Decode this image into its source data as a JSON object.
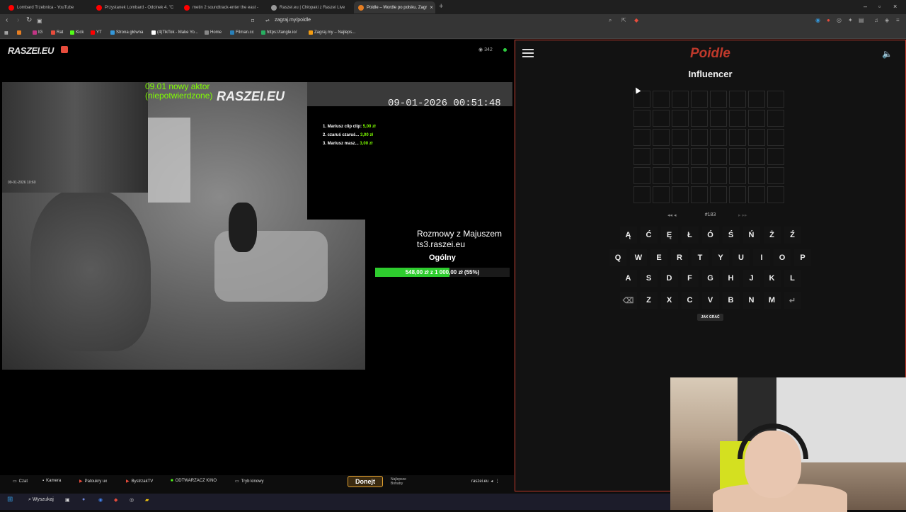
{
  "browser": {
    "tabs": [
      {
        "label": "Lombard Trzebnica - YouTube",
        "color": "#ff0000"
      },
      {
        "label": "Przystanek Lombard - Odcinek 4. \"C",
        "color": "#ff0000"
      },
      {
        "label": "metin 2 soundtrack-enter the east -",
        "color": "#ff0000"
      },
      {
        "label": "Raszei.eu | Chłopaki z Raszei Live",
        "color": "#999999"
      },
      {
        "label": "Poidle – Wordle po polsku. Zagr",
        "color": "#e67e22"
      }
    ],
    "url": "zagraj.my/poidle",
    "bookmarks": [
      "IG",
      "Rat",
      "Kick",
      "YT",
      "Strona główna",
      "(4)TikTok - Make Yo...",
      "Home",
      "Filman.cc",
      "https://tangle.io/",
      "Zagraj.my – Najleps..."
    ]
  },
  "stream": {
    "logo": "RASZEI.EU",
    "viewers": "342",
    "overlay_green": [
      "09.01 nowy aktor",
      "(niepotwierdzone)"
    ],
    "watermark": "RASZEI.EU",
    "ranking": [
      {
        "name": "1. Mariusz clip clip:",
        "amount": "5,00 zł"
      },
      {
        "name": "2. czaruś czaruś...",
        "amount": "3,00 zł"
      },
      {
        "name": "3. Mariusz masz...",
        "amount": "3,00 zł"
      }
    ],
    "datetime": "09-01-2026 00:51:48",
    "cam_timestamp": "09-01-2026 10:60",
    "rozmowy": [
      "Rozmowy z Majuszem",
      "ts3.raszei.eu"
    ],
    "goal_label": "Ogólny",
    "goal_text": "548,00 zł z 1 000,00 zł (55%)",
    "goal_fraction": 0.55,
    "footer": [
      "Czat",
      "Kamera",
      "Patoukry ux",
      "BystrzakTV",
      "ODTWARZACZ KINO",
      "Tryb kinowy"
    ],
    "donate": "Donejt",
    "najlepsze": [
      "Najlepsze",
      "Bohatry"
    ],
    "footer_right": "raszei.eu"
  },
  "game": {
    "title": "Poidle",
    "subtitle": "Influencer",
    "puzzle_number": "#183",
    "keyboard": [
      [
        "Ą",
        "Ć",
        "Ę",
        "Ł",
        "Ó",
        "Ś",
        "Ń",
        "Ż",
        "Ź"
      ],
      [
        "Q",
        "W",
        "E",
        "R",
        "T",
        "Y",
        "U",
        "I",
        "O",
        "P"
      ],
      [
        "A",
        "S",
        "D",
        "F",
        "G",
        "H",
        "J",
        "K",
        "L"
      ],
      [
        "⌫",
        "Z",
        "X",
        "C",
        "V",
        "B",
        "N",
        "M",
        "↵"
      ]
    ],
    "howto": "JAK GRAĆ"
  },
  "taskbar": {
    "search": "Wyszukaj"
  }
}
